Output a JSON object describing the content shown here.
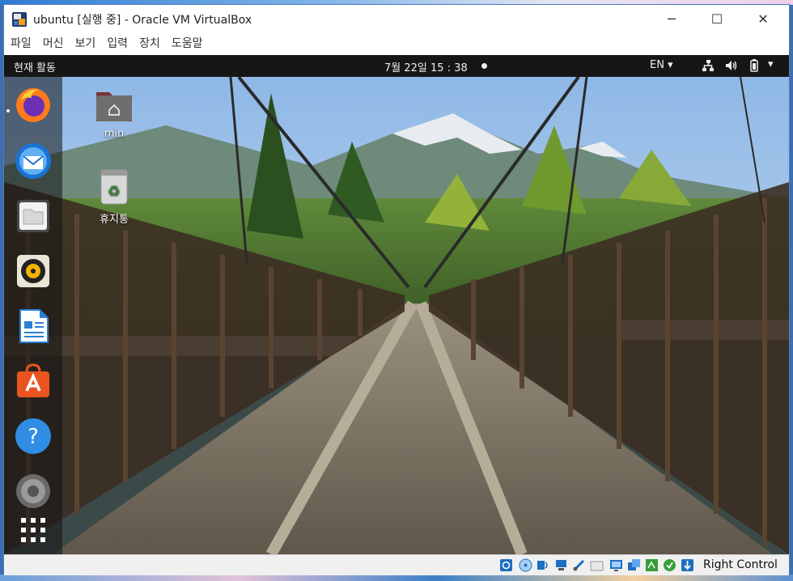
{
  "window": {
    "title": "ubuntu [실행 중] - Oracle VM VirtualBox",
    "controls": {
      "minimize": "─",
      "maximize": "☐",
      "close": "✕"
    }
  },
  "menu": [
    "파일",
    "머신",
    "보기",
    "입력",
    "장치",
    "도움말"
  ],
  "topbar": {
    "activities": "현재 활동",
    "clock": "7월 22일  15 : 38",
    "language": "EN ▾",
    "menu_arrow": "▾"
  },
  "dock": [
    {
      "name": "firefox",
      "running": true
    },
    {
      "name": "thunderbird"
    },
    {
      "name": "files"
    },
    {
      "name": "rhythmbox"
    },
    {
      "name": "libreoffice-writer"
    },
    {
      "name": "ubuntu-software"
    },
    {
      "name": "help"
    },
    {
      "name": "settings"
    },
    {
      "name": "show-applications"
    }
  ],
  "desktop": {
    "home_label": "min",
    "trash_label": "휴지통"
  },
  "status": {
    "host_key": "Right Control"
  },
  "colors": {
    "ubuntu_orange": "#e95420",
    "topbar": "#161616",
    "vbox_blue": "#1e6fc0"
  }
}
